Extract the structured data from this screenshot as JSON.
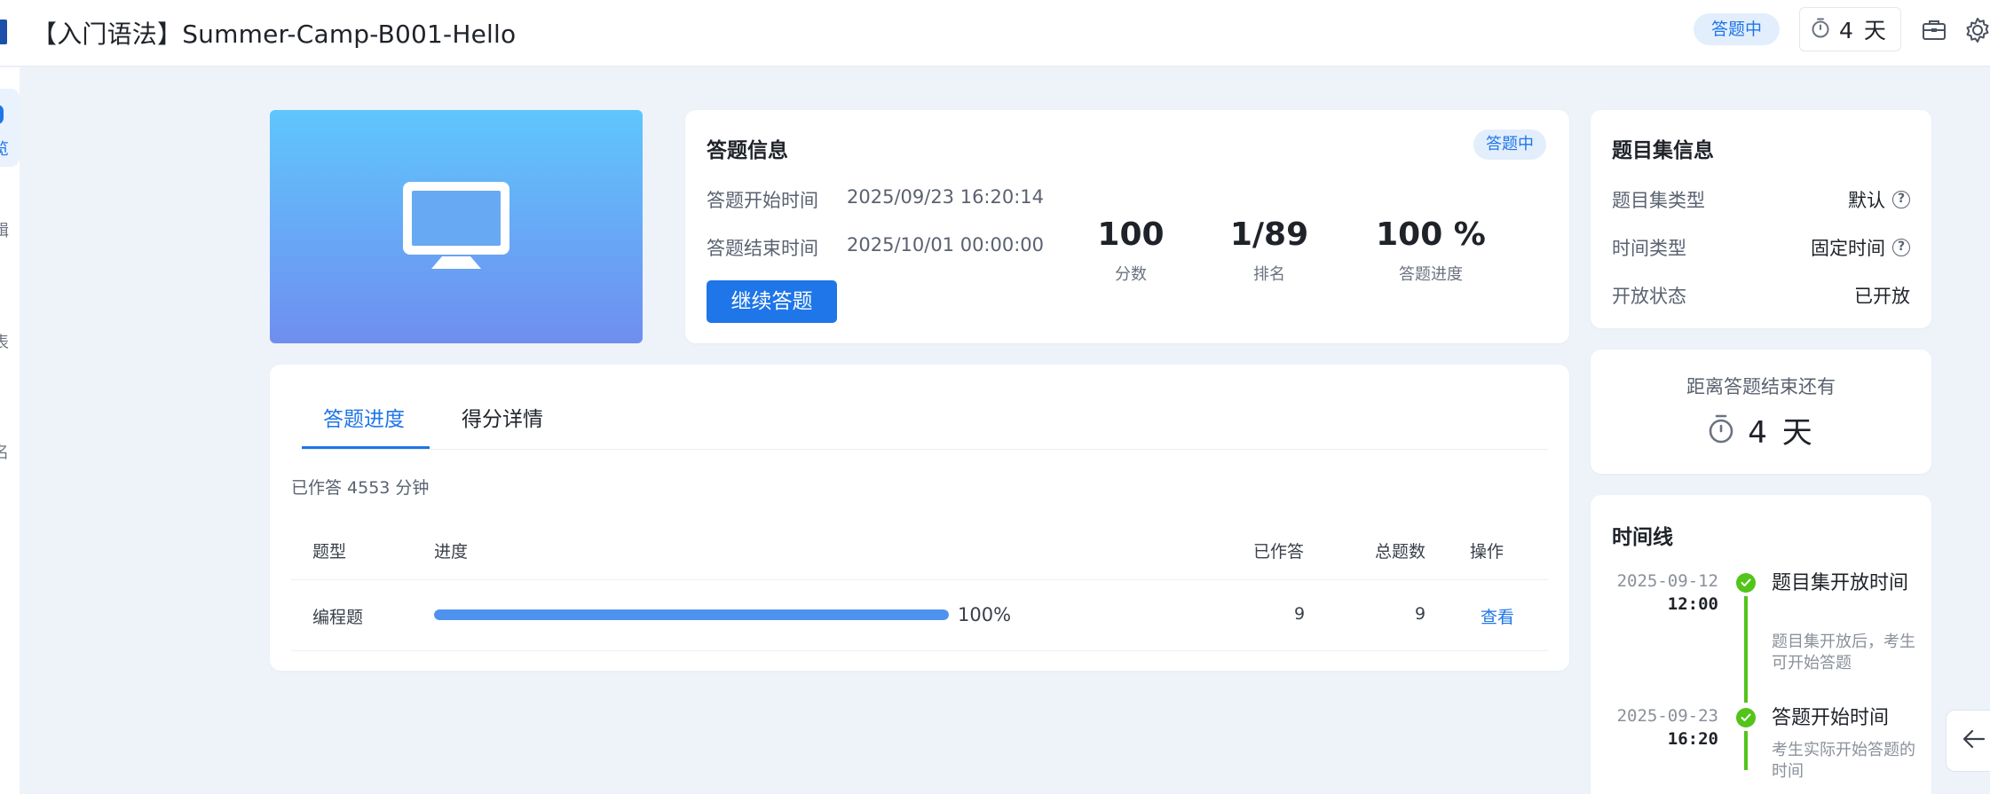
{
  "header": {
    "title": "【入门语法】Summer-Camp-B001-Hello",
    "status": "答题中",
    "timer": "4 天"
  },
  "sidebar": {
    "frags": [
      "览",
      "辑",
      "表",
      "名"
    ]
  },
  "answer_info": {
    "title": "答题信息",
    "status": "答题中",
    "start_label": "答题开始时间",
    "start_value": "2025/09/23 16:20:14",
    "end_label": "答题结束时间",
    "end_value": "2025/10/01 00:00:00",
    "continue_label": "继续答题",
    "stats": [
      {
        "value": "100",
        "label": "分数"
      },
      {
        "value": "1/89",
        "label": "排名"
      },
      {
        "value": "100 %",
        "label": "答题进度"
      }
    ]
  },
  "set_info": {
    "title": "题目集信息",
    "rows": [
      {
        "label": "题目集类型",
        "value": "默认"
      },
      {
        "label": "时间类型",
        "value": "固定时间"
      },
      {
        "label": "开放状态",
        "value": "已开放"
      }
    ]
  },
  "countdown": {
    "label": "距离答题结束还有",
    "value": "4 天"
  },
  "timeline": {
    "title": "时间线",
    "items": [
      {
        "date": "2025-09-12",
        "time": "12:00",
        "title": "题目集开放时间",
        "desc": "题目集开放后，考生可开始答题"
      },
      {
        "date": "2025-09-23",
        "time": "16:20",
        "title": "答题开始时间",
        "desc": "考生实际开始答题的时间"
      }
    ]
  },
  "progress": {
    "tabs": [
      "答题进度",
      "得分详情"
    ],
    "elapsed": "已作答 4553 分钟",
    "columns": [
      "题型",
      "进度",
      "已作答",
      "总题数",
      "操作"
    ],
    "rows": [
      {
        "type": "编程题",
        "progress": 1.0,
        "progress_label": "100%",
        "answered": "9",
        "total": "9",
        "action": "查看"
      }
    ]
  }
}
